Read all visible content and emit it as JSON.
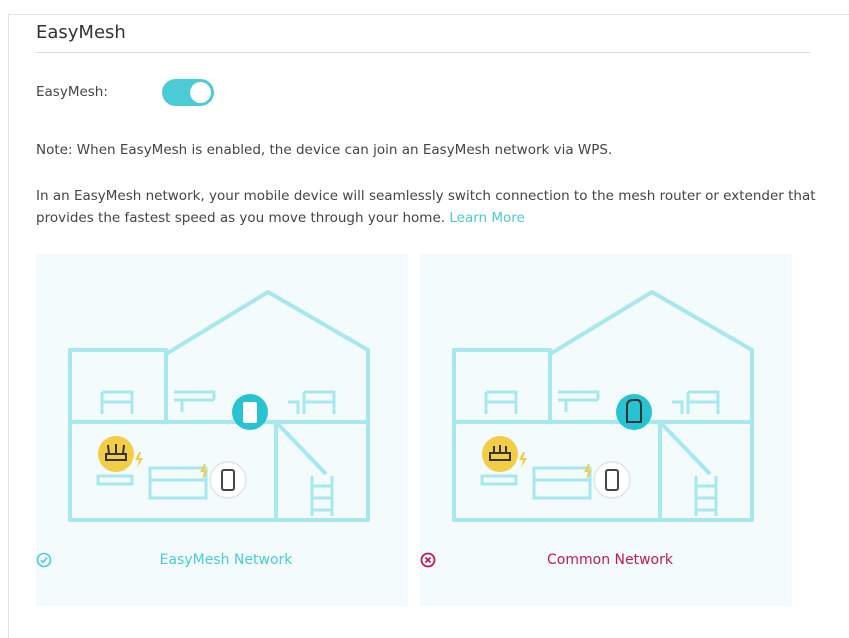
{
  "section": {
    "title": "EasyMesh"
  },
  "toggle": {
    "label": "EasyMesh:",
    "state": "on",
    "color": "#4acbd6"
  },
  "note": "Note: When EasyMesh is enabled, the device can join an EasyMesh network via WPS.",
  "description": {
    "text": "In an EasyMesh network, your mobile device will seamlessly switch connection to the mesh router or extender that provides the fastest speed as you move through your home.",
    "link": "Learn More"
  },
  "panels": [
    {
      "caption": "EasyMesh Network",
      "icon": "check-circle-icon",
      "color": "#4acbd6"
    },
    {
      "caption": "Common Network",
      "icon": "x-circle-icon",
      "color": "#c2185b"
    }
  ]
}
